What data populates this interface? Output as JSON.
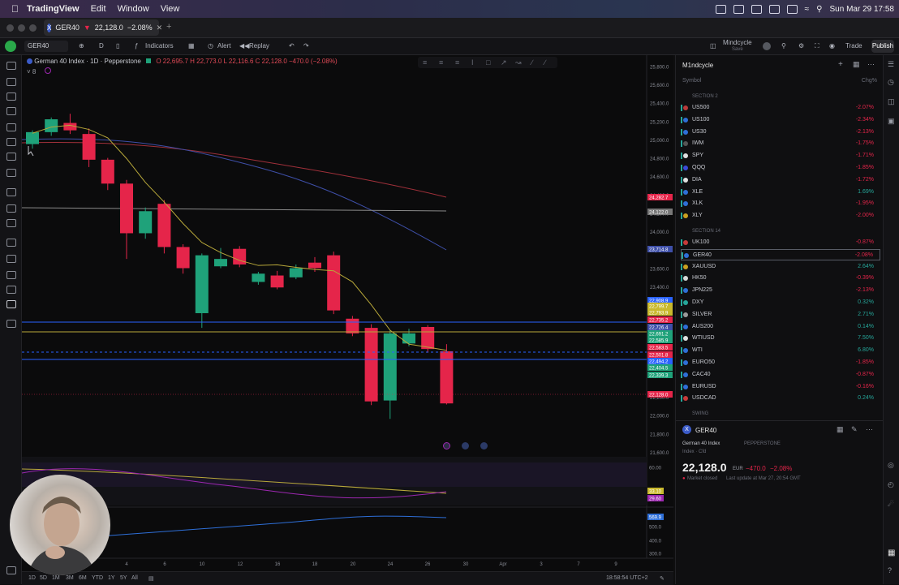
{
  "menubar": {
    "app": "TradingView",
    "items": [
      "Edit",
      "Window",
      "View"
    ],
    "datetime": "Sun Mar 29  17:58"
  },
  "tab": {
    "symbol": "GER40",
    "price": "22,128.0",
    "change": "−2.08%"
  },
  "toolbar": {
    "symbol": "GER40",
    "interval": "D",
    "indicators": "Indicators",
    "alert": "Alert",
    "replay": "Replay",
    "layout_name": "Mindcycle",
    "layout_sub": "Save",
    "trade": "Trade",
    "publish": "Publish"
  },
  "chart": {
    "title": "German 40 Index · 1D · Pepperstone",
    "ohlc": "O 22,695.7  H 22,773.0  L 22,116.6  C 22,128.0  −470.0 (−2.08%)",
    "indicator_count": "8",
    "colors": {
      "up": "#1fa27a",
      "down": "#e5254a",
      "ma_yellow": "#b8a83a",
      "ma_red": "#a0303a",
      "ma_blue": "#3e4fa8",
      "ma_gray": "#8a8a8a"
    }
  },
  "chart_data": {
    "type": "candlestick",
    "title": "German 40 Index · 1D · Pepperstone",
    "ylim": [
      21600,
      25900
    ],
    "price_axis": [
      "25,800.0",
      "25,600.0",
      "25,400.0",
      "25,200.0",
      "25,000.0",
      "24,800.0",
      "24,600.0",
      "24,400.0",
      "24,200.0",
      "24,000.0",
      "23,800.0",
      "23,600.0",
      "23,400.0",
      "23,200.0",
      "22,200.0",
      "22,000.0",
      "21,800.0",
      "21,600.0"
    ],
    "time_axis": [
      "4",
      "6",
      "10",
      "12",
      "16",
      "18",
      "20",
      "24",
      "26",
      "30",
      "Apr",
      "3",
      "7",
      "9"
    ],
    "candles": [
      {
        "o": 24950,
        "c": 25080,
        "h": 25100,
        "l": 24900
      },
      {
        "o": 25080,
        "c": 25220,
        "h": 25240,
        "l": 25040
      },
      {
        "o": 25180,
        "c": 25100,
        "h": 25280,
        "l": 25060
      },
      {
        "o": 25060,
        "c": 24780,
        "h": 25120,
        "l": 24700
      },
      {
        "o": 24780,
        "c": 24520,
        "h": 24800,
        "l": 24450
      },
      {
        "o": 24520,
        "c": 23980,
        "h": 24560,
        "l": 23700
      },
      {
        "o": 23980,
        "c": 24220,
        "h": 24260,
        "l": 23920
      },
      {
        "o": 24300,
        "c": 23830,
        "h": 24340,
        "l": 23760
      },
      {
        "o": 23830,
        "c": 23600,
        "h": 23860,
        "l": 23540
      },
      {
        "o": 23110,
        "c": 23740,
        "h": 23760,
        "l": 22950
      },
      {
        "o": 23620,
        "c": 23700,
        "h": 23820,
        "l": 23600
      },
      {
        "o": 23810,
        "c": 23640,
        "h": 23840,
        "l": 23610
      },
      {
        "o": 23450,
        "c": 23540,
        "h": 23560,
        "l": 23420
      },
      {
        "o": 23520,
        "c": 23390,
        "h": 23570,
        "l": 23370
      },
      {
        "o": 23500,
        "c": 23600,
        "h": 23640,
        "l": 23480
      },
      {
        "o": 23660,
        "c": 23600,
        "h": 23720,
        "l": 23560
      },
      {
        "o": 23740,
        "c": 23140,
        "h": 23780,
        "l": 23100
      },
      {
        "o": 23050,
        "c": 22890,
        "h": 23080,
        "l": 22860
      },
      {
        "o": 22950,
        "c": 22150,
        "h": 22990,
        "l": 22110
      },
      {
        "o": 22160,
        "c": 22890,
        "h": 22920,
        "l": 21960
      },
      {
        "o": 22780,
        "c": 22890,
        "h": 22940,
        "l": 22750
      },
      {
        "o": 22960,
        "c": 22720,
        "h": 22980,
        "l": 22680
      },
      {
        "o": 22695.7,
        "c": 22128.0,
        "h": 22773.0,
        "l": 22116.6
      }
    ],
    "price_labels": [
      {
        "text": "24,282.7",
        "color": "#e5254a"
      },
      {
        "text": "24,122.0",
        "color": "#777777"
      },
      {
        "text": "23,714.8",
        "color": "#3e4fa8"
      },
      {
        "text": "22,908.9",
        "color": "#2962ff"
      },
      {
        "text": "22,799.7",
        "color": "#c9b92d"
      },
      {
        "text": "22,793.9",
        "color": "#c9b92d"
      },
      {
        "text": "22,735.2",
        "color": "#e5254a"
      },
      {
        "text": "22,726.4",
        "color": "#3e4fa8"
      },
      {
        "text": "22,691.2",
        "color": "#1fa27a"
      },
      {
        "text": "22,585.9",
        "color": "#1fa27a"
      },
      {
        "text": "22,583.5",
        "color": "#e5254a"
      },
      {
        "text": "22,501.8",
        "color": "#e5254a"
      },
      {
        "text": "22,494.2",
        "color": "#2962ff"
      },
      {
        "text": "22,404.5",
        "color": "#1fa27a"
      },
      {
        "text": "22,339.3",
        "color": "#1fa27a"
      },
      {
        "text": "22,128.0",
        "color": "#e5254a"
      }
    ],
    "indicator_pane": {
      "labels": [
        "60.00",
        "33.10",
        "29.60"
      ],
      "label_colors": [
        "#888888",
        "#c9b92d",
        "#9c27b0"
      ]
    },
    "volume_pane": {
      "labels": [
        "569.9",
        "500.0",
        "400.0",
        "300.0"
      ]
    }
  },
  "bottombar": {
    "timeframes": [
      "1D",
      "5D",
      "1M",
      "3M",
      "6M",
      "YTD",
      "1Y",
      "5Y",
      "All"
    ],
    "clock": "18:58:54 UTC+2"
  },
  "watchlist": {
    "name": "M1ndcycle",
    "col_symbol": "Symbol",
    "col_change": "Chg%",
    "section1": "SECTION 2",
    "section2": "SECTION 14",
    "section3": "SWING",
    "rows1": [
      {
        "sym": "US500",
        "chg": "-2.07%",
        "color": "#e5254a",
        "dot": "#b83a3a"
      },
      {
        "sym": "US100",
        "chg": "-2.34%",
        "color": "#e5254a",
        "dot": "#2e6fd8"
      },
      {
        "sym": "US30",
        "chg": "-2.13%",
        "color": "#e5254a",
        "dot": "#2e6fd8"
      },
      {
        "sym": "IWM",
        "chg": "-1.75%",
        "color": "#e5254a",
        "dot": "#555555"
      },
      {
        "sym": "SPY",
        "chg": "-1.71%",
        "color": "#e5254a",
        "dot": "#e0e0e0"
      },
      {
        "sym": "QQQ",
        "chg": "-1.85%",
        "color": "#e5254a",
        "dot": "#3a4ad8"
      },
      {
        "sym": "DIA",
        "chg": "-1.72%",
        "color": "#e5254a",
        "dot": "#e0e0e0"
      },
      {
        "sym": "XLE",
        "chg": "1.69%",
        "color": "#26a69a",
        "dot": "#2e6fd8"
      },
      {
        "sym": "XLK",
        "chg": "-1.95%",
        "color": "#e5254a",
        "dot": "#2e6fd8"
      },
      {
        "sym": "XLY",
        "chg": "-2.00%",
        "color": "#e5254a",
        "dot": "#c9a020"
      }
    ],
    "rows2": [
      {
        "sym": "UK100",
        "chg": "-0.87%",
        "color": "#e5254a",
        "dot": "#c83a3a"
      },
      {
        "sym": "GER40",
        "chg": "-2.08%",
        "color": "#e5254a",
        "dot": "#2e6fd8",
        "selected": true
      },
      {
        "sym": "XAUUSD",
        "chg": "2.64%",
        "color": "#26a69a",
        "dot": "#c9a020"
      },
      {
        "sym": "HK50",
        "chg": "-0.39%",
        "color": "#e5254a",
        "dot": "#d8d8d8"
      },
      {
        "sym": "JPN225",
        "chg": "-2.13%",
        "color": "#e5254a",
        "dot": "#2e6fd8"
      },
      {
        "sym": "DXY",
        "chg": "0.32%",
        "color": "#26a69a",
        "dot": "#26a69a"
      },
      {
        "sym": "SILVER",
        "chg": "2.71%",
        "color": "#26a69a",
        "dot": "#9a9a9a"
      },
      {
        "sym": "AUS200",
        "chg": "0.14%",
        "color": "#26a69a",
        "dot": "#2e6fd8"
      },
      {
        "sym": "WTIUSD",
        "chg": "7.50%",
        "color": "#26a69a",
        "dot": "#e0e0e0"
      },
      {
        "sym": "WTI",
        "chg": "6.80%",
        "color": "#26a69a",
        "dot": "#2e6fd8"
      },
      {
        "sym": "EURO50",
        "chg": "-1.85%",
        "color": "#e5254a",
        "dot": "#2e6fd8"
      },
      {
        "sym": "CAC40",
        "chg": "-0.87%",
        "color": "#e5254a",
        "dot": "#2e6fd8"
      },
      {
        "sym": "EURUSD",
        "chg": "-0.16%",
        "color": "#e5254a",
        "dot": "#2e6fd8"
      },
      {
        "sym": "USDCAD",
        "chg": "0.24%",
        "color": "#26a69a",
        "dot": "#c83a3a"
      }
    ]
  },
  "details": {
    "symbol": "GER40",
    "name": "German 40 Index",
    "exchange": "PEPPERSTONE",
    "type": "Index · Cfd",
    "price": "22,128.0",
    "currency": "EUR",
    "change": "−470.0",
    "change_pct": "−2.08%",
    "status": "Market closed",
    "last_update": "Last update at Mar 27, 20:54 GMT"
  }
}
